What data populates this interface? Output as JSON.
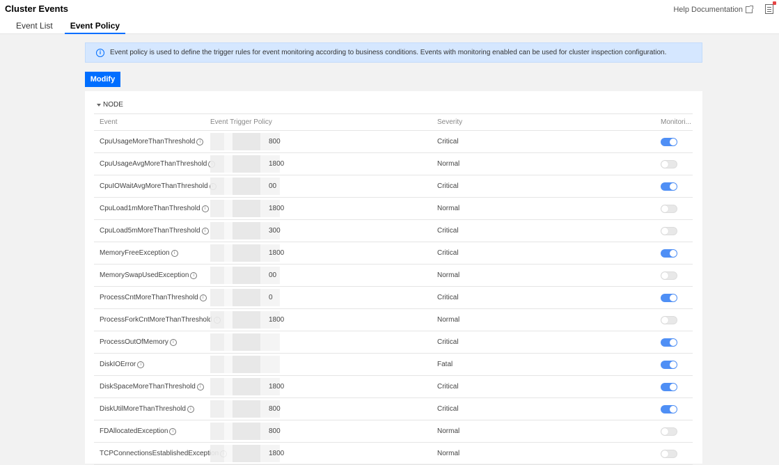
{
  "header": {
    "title": "Cluster Events",
    "help_label": "Help Documentation"
  },
  "tabs": [
    {
      "label": "Event List",
      "active": false
    },
    {
      "label": "Event Policy",
      "active": true
    }
  ],
  "banner": {
    "text": "Event policy is used to define the trigger rules for event monitoring according to business conditions. Events with monitoring enabled can be used for cluster inspection configuration."
  },
  "toolbar": {
    "modify_label": "Modify"
  },
  "section": {
    "label": "NODE"
  },
  "table": {
    "columns": [
      "Event",
      "Event Trigger Policy",
      "Severity",
      "Monitori..."
    ],
    "rows": [
      {
        "event": "CpuUsageMoreThanThreshold",
        "policy": "800",
        "severity": "Critical",
        "monitoring": true
      },
      {
        "event": "CpuUsageAvgMoreThanThreshold",
        "policy": "1800",
        "severity": "Normal",
        "monitoring": false
      },
      {
        "event": "CpuIOWaitAvgMoreThanThreshold",
        "policy": "00",
        "severity": "Critical",
        "monitoring": true
      },
      {
        "event": "CpuLoad1mMoreThanThreshold",
        "policy": "1800",
        "severity": "Normal",
        "monitoring": false
      },
      {
        "event": "CpuLoad5mMoreThanThreshold",
        "policy": "300",
        "severity": "Critical",
        "monitoring": false
      },
      {
        "event": "MemoryFreeException",
        "policy": "1800",
        "severity": "Critical",
        "monitoring": true
      },
      {
        "event": "MemorySwapUsedException",
        "policy": "00",
        "severity": "Normal",
        "monitoring": false
      },
      {
        "event": "ProcessCntMoreThanThreshold",
        "policy": "0",
        "severity": "Critical",
        "monitoring": true
      },
      {
        "event": "ProcessForkCntMoreThanThreshold",
        "policy": "1800",
        "severity": "Normal",
        "monitoring": false
      },
      {
        "event": "ProcessOutOfMemory",
        "policy": "",
        "severity": "Critical",
        "monitoring": true
      },
      {
        "event": "DiskIOError",
        "policy": "",
        "severity": "Fatal",
        "monitoring": true
      },
      {
        "event": "DiskSpaceMoreThanThreshold",
        "policy": "1800",
        "severity": "Critical",
        "monitoring": true
      },
      {
        "event": "DiskUtilMoreThanThreshold",
        "policy": "800",
        "severity": "Critical",
        "monitoring": true
      },
      {
        "event": "FDAllocatedException",
        "policy": "800",
        "severity": "Normal",
        "monitoring": false
      },
      {
        "event": "TCPConnectionsEstablishedException",
        "policy": "1800",
        "severity": "Normal",
        "monitoring": false
      }
    ]
  }
}
